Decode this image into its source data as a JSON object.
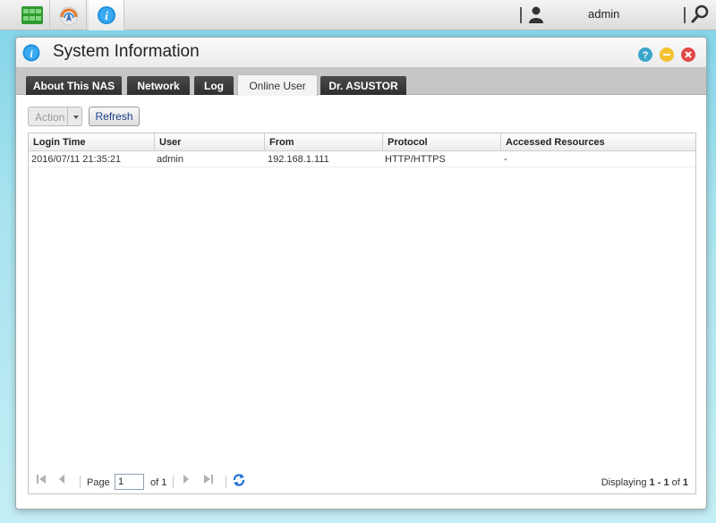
{
  "taskbar": {
    "apps": [
      {
        "name": "storage-manager",
        "icon": "grid-icon"
      },
      {
        "name": "app-central",
        "icon": "app-central-icon"
      },
      {
        "name": "system-information",
        "icon": "info-icon"
      }
    ],
    "username": "admin"
  },
  "window": {
    "title": "System Information",
    "tabs": [
      {
        "label": "About This NAS"
      },
      {
        "label": "Network"
      },
      {
        "label": "Log"
      },
      {
        "label": "Online User"
      },
      {
        "label": "Dr. ASUSTOR"
      }
    ],
    "active_tab": "Online User"
  },
  "toolbar": {
    "action_label": "Action",
    "refresh_label": "Refresh"
  },
  "grid": {
    "columns": [
      "Login Time",
      "User",
      "From",
      "Protocol",
      "Accessed Resources"
    ],
    "rows": [
      [
        "2016/07/11 21:35:21",
        "admin",
        "192.168.1.111",
        "HTTP/HTTPS",
        "-"
      ]
    ]
  },
  "pager": {
    "page_label": "Page",
    "page_value": "1",
    "of_label": "of 1",
    "display_prefix": "Displaying",
    "display_range": "1 - 1",
    "display_of": "of",
    "display_total": "1"
  },
  "colors": {
    "help": "#3aa6c9",
    "minimize": "#f2c12e",
    "close": "#e04848",
    "refresh_icon": "#1e6fd1"
  }
}
